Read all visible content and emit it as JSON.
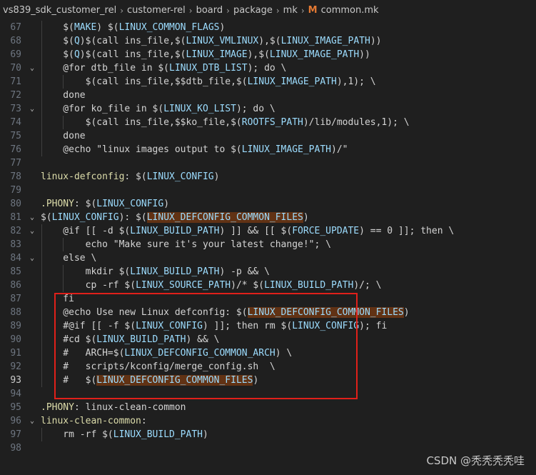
{
  "breadcrumb": {
    "items": [
      "vs839_sdk_customer_rel",
      "customer-rel",
      "board",
      "package",
      "mk"
    ],
    "file_icon": "M",
    "file_name": "common.mk"
  },
  "editor": {
    "active_line": 93,
    "lines": [
      {
        "n": 67,
        "fold": "",
        "segs": [
          [
            "lit",
            "    $("
          ],
          [
            "var",
            "MAKE"
          ],
          [
            "lit",
            ") $("
          ],
          [
            "var",
            "LINUX_COMMON_FLAGS"
          ],
          [
            "lit",
            ")"
          ]
        ]
      },
      {
        "n": 68,
        "fold": "",
        "segs": [
          [
            "lit",
            "    $("
          ],
          [
            "var",
            "Q"
          ],
          [
            "lit",
            ")$(call ins_file,$("
          ],
          [
            "var",
            "LINUX_VMLINUX"
          ],
          [
            "lit",
            "),$("
          ],
          [
            "var",
            "LINUX_IMAGE_PATH"
          ],
          [
            "lit",
            "))"
          ]
        ]
      },
      {
        "n": 69,
        "fold": "",
        "segs": [
          [
            "lit",
            "    $("
          ],
          [
            "var",
            "Q"
          ],
          [
            "lit",
            ")$(call ins_file,$("
          ],
          [
            "var",
            "LINUX_IMAGE"
          ],
          [
            "lit",
            "),$("
          ],
          [
            "var",
            "LINUX_IMAGE_PATH"
          ],
          [
            "lit",
            "))"
          ]
        ]
      },
      {
        "n": 70,
        "fold": "v",
        "segs": [
          [
            "lit",
            "    @for dtb_file in $("
          ],
          [
            "var",
            "LINUX_DTB_LIST"
          ],
          [
            "lit",
            "); do \\"
          ]
        ]
      },
      {
        "n": 71,
        "fold": "",
        "segs": [
          [
            "lit",
            "        $(call ins_file,$$dtb_file,$("
          ],
          [
            "var",
            "LINUX_IMAGE_PATH"
          ],
          [
            "lit",
            "),1); \\"
          ]
        ]
      },
      {
        "n": 72,
        "fold": "",
        "segs": [
          [
            "lit",
            "    done"
          ]
        ]
      },
      {
        "n": 73,
        "fold": "v",
        "segs": [
          [
            "lit",
            "    @for ko_file in $("
          ],
          [
            "var",
            "LINUX_KO_LIST"
          ],
          [
            "lit",
            "); do \\"
          ]
        ]
      },
      {
        "n": 74,
        "fold": "",
        "segs": [
          [
            "lit",
            "        $(call ins_file,$$ko_file,$("
          ],
          [
            "var",
            "ROOTFS_PATH"
          ],
          [
            "lit",
            ")/lib/modules,1); \\"
          ]
        ]
      },
      {
        "n": 75,
        "fold": "",
        "segs": [
          [
            "lit",
            "    done"
          ]
        ]
      },
      {
        "n": 76,
        "fold": "",
        "segs": [
          [
            "lit",
            "    @echo \"linux images output to $("
          ],
          [
            "var",
            "LINUX_IMAGE_PATH"
          ],
          [
            "lit",
            ")/\""
          ]
        ]
      },
      {
        "n": 77,
        "fold": "",
        "segs": []
      },
      {
        "n": 78,
        "fold": "",
        "segs": [
          [
            "target",
            "linux-defconfig"
          ],
          [
            "lit",
            ": $("
          ],
          [
            "var",
            "LINUX_CONFIG"
          ],
          [
            "lit",
            ")"
          ]
        ]
      },
      {
        "n": 79,
        "fold": "",
        "segs": []
      },
      {
        "n": 80,
        "fold": "",
        "segs": [
          [
            "target",
            ".PHONY"
          ],
          [
            "lit",
            ": $("
          ],
          [
            "var",
            "LINUX_CONFIG"
          ],
          [
            "lit",
            ")"
          ]
        ]
      },
      {
        "n": 81,
        "fold": "v",
        "segs": [
          [
            "lit",
            "$("
          ],
          [
            "var",
            "LINUX_CONFIG"
          ],
          [
            "lit",
            "): $("
          ],
          [
            "hl",
            "LINUX_DEFCONFIG_COMMON_FILES"
          ],
          [
            "lit",
            ")"
          ]
        ]
      },
      {
        "n": 82,
        "fold": "v",
        "segs": [
          [
            "lit",
            "    @if [[ -d $("
          ],
          [
            "var",
            "LINUX_BUILD_PATH"
          ],
          [
            "lit",
            ") ]] && [[ $("
          ],
          [
            "var",
            "FORCE_UPDATE"
          ],
          [
            "lit",
            ") == 0 ]]; then \\"
          ]
        ]
      },
      {
        "n": 83,
        "fold": "",
        "segs": [
          [
            "lit",
            "        echo \"Make sure it's your latest change!\"; \\"
          ]
        ]
      },
      {
        "n": 84,
        "fold": "v",
        "segs": [
          [
            "lit",
            "    else \\"
          ]
        ]
      },
      {
        "n": 85,
        "fold": "",
        "segs": [
          [
            "lit",
            "        mkdir $("
          ],
          [
            "var",
            "LINUX_BUILD_PATH"
          ],
          [
            "lit",
            ") -p && \\"
          ]
        ]
      },
      {
        "n": 86,
        "fold": "",
        "segs": [
          [
            "lit",
            "        cp -rf $("
          ],
          [
            "var",
            "LINUX_SOURCE_PATH"
          ],
          [
            "lit",
            ")/* $("
          ],
          [
            "var",
            "LINUX_BUILD_PATH"
          ],
          [
            "lit",
            ")/; \\"
          ]
        ]
      },
      {
        "n": 87,
        "fold": "",
        "segs": [
          [
            "lit",
            "    fi"
          ]
        ]
      },
      {
        "n": 88,
        "fold": "",
        "segs": [
          [
            "lit",
            "    @echo Use new Linux defconfig: $("
          ],
          [
            "hl",
            "LINUX_DEFCONFIG_COMMON_FILES"
          ],
          [
            "lit",
            ")"
          ]
        ]
      },
      {
        "n": 89,
        "fold": "",
        "segs": [
          [
            "lit",
            "    #@if [[ -f $("
          ],
          [
            "var",
            "LINUX_CONFIG"
          ],
          [
            "lit",
            ") ]]; then rm $("
          ],
          [
            "var",
            "LINUX_CONFIG"
          ],
          [
            "lit",
            "); fi"
          ]
        ]
      },
      {
        "n": 90,
        "fold": "",
        "segs": [
          [
            "lit",
            "    #cd $("
          ],
          [
            "var",
            "LINUX_BUILD_PATH"
          ],
          [
            "lit",
            ") && \\"
          ]
        ]
      },
      {
        "n": 91,
        "fold": "",
        "segs": [
          [
            "lit",
            "    #   ARCH=$("
          ],
          [
            "var",
            "LINUX_DEFCONFIG_COMMON_ARCH"
          ],
          [
            "lit",
            ") \\"
          ]
        ]
      },
      {
        "n": 92,
        "fold": "",
        "segs": [
          [
            "lit",
            "    #   scripts/kconfig/merge_config.sh  \\"
          ]
        ]
      },
      {
        "n": 93,
        "fold": "",
        "segs": [
          [
            "lit",
            "    #   $("
          ],
          [
            "hl",
            "LINUX_DEFCONFIG_COMMON_FILES"
          ],
          [
            "lit",
            ")"
          ]
        ]
      },
      {
        "n": 94,
        "fold": "",
        "segs": []
      },
      {
        "n": 95,
        "fold": "",
        "segs": [
          [
            "target",
            ".PHONY"
          ],
          [
            "lit",
            ": linux-clean-common"
          ]
        ]
      },
      {
        "n": 96,
        "fold": "v",
        "segs": [
          [
            "target",
            "linux-clean-common"
          ],
          [
            "lit",
            ":"
          ]
        ]
      },
      {
        "n": 97,
        "fold": "",
        "segs": [
          [
            "lit",
            "    rm -rf $("
          ],
          [
            "var",
            "LINUX_BUILD_PATH"
          ],
          [
            "lit",
            ")"
          ]
        ]
      },
      {
        "n": 98,
        "fold": "",
        "segs": []
      }
    ]
  },
  "watermark": "CSDN @秃秃秃秃哇"
}
